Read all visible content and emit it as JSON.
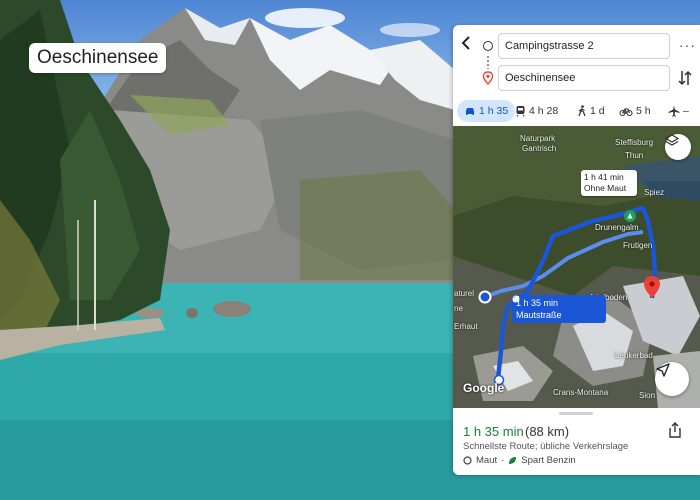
{
  "photo": {
    "place_label": "Oeschinensee"
  },
  "directions": {
    "origin_value": "Campingstrasse 2",
    "destination_value": "Oeschinensee",
    "more_label": "···",
    "modes": [
      {
        "icon": "car-icon",
        "label": "1 h 35",
        "active": true
      },
      {
        "icon": "train-icon",
        "label": "4 h 28"
      },
      {
        "icon": "walk-icon",
        "label": "1 d"
      },
      {
        "icon": "bike-icon",
        "label": "5 h"
      },
      {
        "icon": "plane-icon",
        "label": "–"
      }
    ]
  },
  "map": {
    "places": {
      "naturpark": "Naturpark",
      "gantrisch": "Gantrisch",
      "steffisburg": "Steffisburg",
      "thun": "Thun",
      "spiez": "Spiez",
      "drunengalm": "Drunengalm",
      "frutigen": "Frutigen",
      "adelboden": "Adelboden",
      "leukerbad": "Leukerbad",
      "crans_montana": "Crans-Montana",
      "sion": "Sion",
      "naturel": "aturel",
      "erhaut": "Erhaut",
      "ne": "ne"
    },
    "alt_route": {
      "time": "1 h 41 min",
      "note": "Ohne Maut"
    },
    "main_route": {
      "time": "1 h 35 min",
      "note": "Mautstraße"
    },
    "logo": "Google"
  },
  "summary": {
    "duration": "1 h 35 min",
    "distance": "(88 km)",
    "description": "Schnellste Route; übliche Verkehrslage",
    "toll_label": "Maut",
    "fuel_label": "Spart Benzin"
  },
  "colors": {
    "route_blue": "#1a56d6",
    "route_alt": "#5b8def",
    "duration_green": "#188038",
    "pin_red": "#ea4335"
  }
}
